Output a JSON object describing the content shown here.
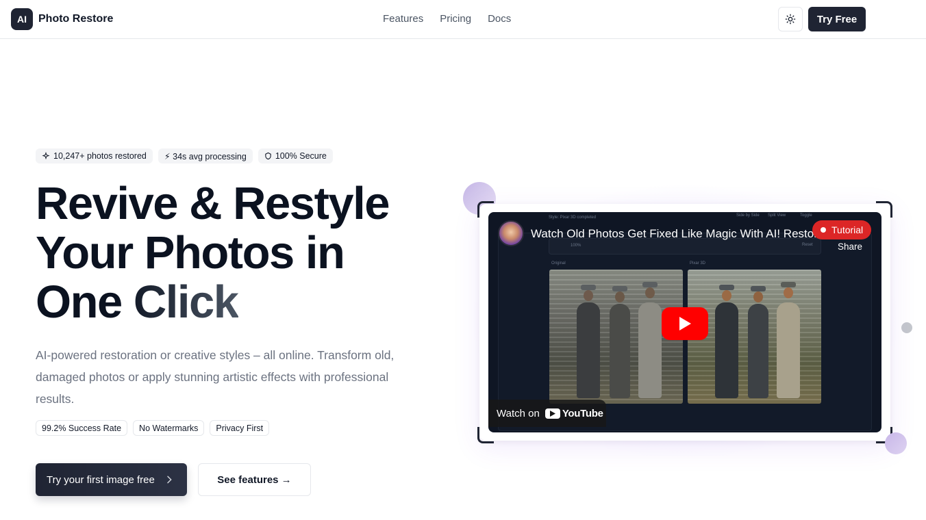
{
  "header": {
    "logo_text": "AI",
    "brand_name": "Photo Restore",
    "nav": [
      "Features",
      "Pricing",
      "Docs"
    ],
    "theme_icon": "sun-icon",
    "try_free_label": "Try Free"
  },
  "badges": [
    {
      "icon": "sparkle-icon",
      "label": "10,247+ photos restored"
    },
    {
      "icon": "bolt-icon",
      "label": "⚡ 34s avg processing"
    },
    {
      "icon": "shield-icon",
      "label": "100% Secure"
    }
  ],
  "hero": {
    "title_line1": "Revive & Restyle",
    "title_line2": "Your Photos in",
    "title_line3": "One Click",
    "description": "AI-powered restoration or creative styles – all online. Transform old, damaged photos or apply stunning artistic effects with professional results.",
    "chips": [
      "99.2% Success Rate",
      "No Watermarks",
      "Privacy First"
    ],
    "cta_primary": "Try your first image free",
    "cta_secondary": "See features →"
  },
  "video": {
    "title": "Watch Old Photos Get Fixed Like Magic With AI! Restore",
    "share_label": "Share",
    "tutorial_badge": "Tutorial",
    "watch_on": "Watch on",
    "youtube_label": "YouTube",
    "inner": {
      "status": "Style: Pixar 3D completed",
      "zoom": "100%",
      "reset": "Reset",
      "modes": [
        "Side by Side",
        "Split View",
        "Toggle"
      ],
      "left_label": "Original",
      "right_label": "Pixar 3D"
    }
  }
}
